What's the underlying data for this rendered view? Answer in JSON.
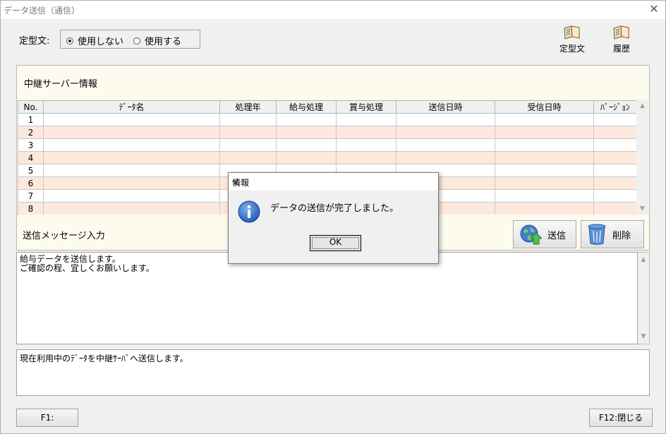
{
  "window": {
    "title": "データ送信（通信）"
  },
  "form": {
    "label": "定型文:",
    "radio_no": "使用しない",
    "radio_yes": "使用する"
  },
  "toolbar": {
    "template_label": "定型文",
    "history_label": "履歴"
  },
  "relay": {
    "title": "中継サーバー情報",
    "columns": [
      "No.",
      "ﾃﾞｰﾀ名",
      "処理年",
      "給与処理",
      "賞与処理",
      "送信日時",
      "受信日時",
      "ﾊﾞｰｼﾞｮﾝ"
    ],
    "rows": [
      [
        "1",
        "",
        "",
        "",
        "",
        "",
        "",
        ""
      ],
      [
        "2",
        "",
        "",
        "",
        "",
        "",
        "",
        ""
      ],
      [
        "3",
        "",
        "",
        "",
        "",
        "",
        "",
        ""
      ],
      [
        "4",
        "",
        "",
        "",
        "",
        "",
        "",
        ""
      ],
      [
        "5",
        "",
        "",
        "",
        "",
        "",
        "",
        ""
      ],
      [
        "6",
        "",
        "",
        "",
        "",
        "",
        "",
        ""
      ],
      [
        "7",
        "",
        "",
        "",
        "",
        "",
        "",
        ""
      ],
      [
        "8",
        "",
        "",
        "",
        "",
        "",
        "",
        ""
      ]
    ]
  },
  "message": {
    "label": "送信メッセージ入力",
    "send_label": "送信",
    "delete_label": "削除",
    "text": "給与データを送信します。\nご確認の程、宜しくお願いします。"
  },
  "status": {
    "text": "現在利用中のﾃﾞｰﾀを中継ｻｰﾊﾞへ送信します。"
  },
  "footer": {
    "f1_label": "F1:",
    "f12_label": "F12:閉じる"
  },
  "dialog": {
    "title": "情報",
    "message": "データの送信が完了しました。",
    "ok_label": "OK"
  },
  "colors": {
    "panel_bg": "#fdfaee",
    "row_alt": "#fde9dc"
  }
}
